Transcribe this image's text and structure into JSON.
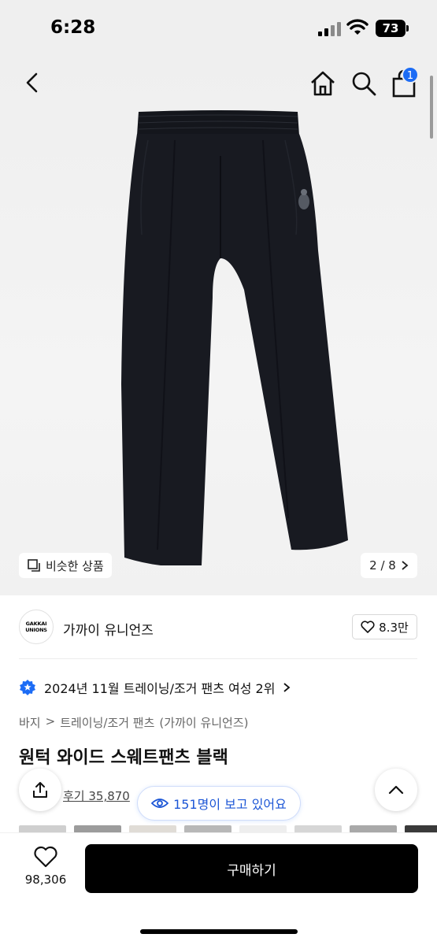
{
  "status": {
    "time": "6:28",
    "battery": "73"
  },
  "header": {
    "cart_count": "1"
  },
  "gallery": {
    "similar_label": "비슷한 상품",
    "page_indicator": "2 / 8"
  },
  "brand": {
    "logo_line1": "GAKKAI",
    "logo_line2": "UNIONS",
    "name": "가까이 유니언즈",
    "likes": "8.3만"
  },
  "ranking": {
    "text": "2024년 11월 트레이닝/조거 팬츠 여성 2위"
  },
  "breadcrumb": {
    "level1": "바지",
    "level2": "트레이닝/조거 팬츠",
    "brand": "(가까이 유니언즈)"
  },
  "product": {
    "title": "원턱 와이드 스웨트팬츠 블랙",
    "reviews": "후기 35,870"
  },
  "viewers": {
    "text": "151명이 보고 있어요"
  },
  "purchase": {
    "wishlist_count": "98,306",
    "buy_label": "구매하기"
  },
  "colors": {
    "accent": "#1c6cf5",
    "button": "#000000"
  },
  "icons": [
    "back-icon",
    "home-icon",
    "search-icon",
    "cart-icon",
    "similar-icon",
    "chevron-right-icon",
    "heart-icon",
    "rank-badge-icon",
    "share-icon",
    "eye-icon",
    "chevron-up-icon"
  ]
}
